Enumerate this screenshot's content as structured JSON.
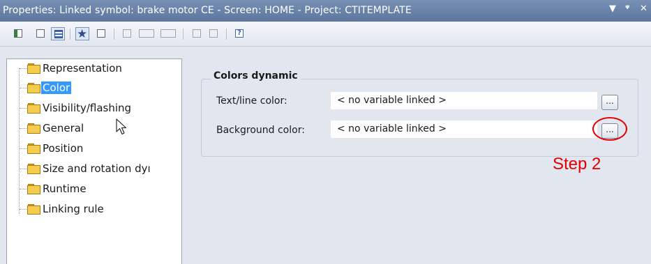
{
  "window": {
    "title": "Properties: Linked symbol: brake motor CE - Screen: HOME - Project: CTITEMPLATE",
    "controls": {
      "dropdown_icon": "▼",
      "pin_icon": "ᵠ",
      "close_icon": "✕"
    }
  },
  "toolbar": {
    "buttons": [
      "tree-view-icon",
      "page-icon",
      "list-view-icon",
      "favorites-star-icon",
      "properties-icon",
      "info-icon",
      "field-icon",
      "field-alt-icon",
      "grid-icon",
      "list-icon",
      "help-icon"
    ]
  },
  "tree": {
    "items": [
      {
        "label": "Representation"
      },
      {
        "label": "Color",
        "selected": true
      },
      {
        "label": "Visibility/flashing"
      },
      {
        "label": "General"
      },
      {
        "label": "Position"
      },
      {
        "label": "Size and rotation dyı"
      },
      {
        "label": "Runtime"
      },
      {
        "label": "Linking rule"
      }
    ]
  },
  "colors_dynamic": {
    "title": "Colors dynamic",
    "text_line": {
      "label": "Text/line color:",
      "value": "< no variable linked >",
      "button": "..."
    },
    "background": {
      "label": "Background color:",
      "value": "< no variable linked >",
      "button": "..."
    }
  },
  "annotation": {
    "text": "Step 2",
    "color": "#e60000"
  }
}
